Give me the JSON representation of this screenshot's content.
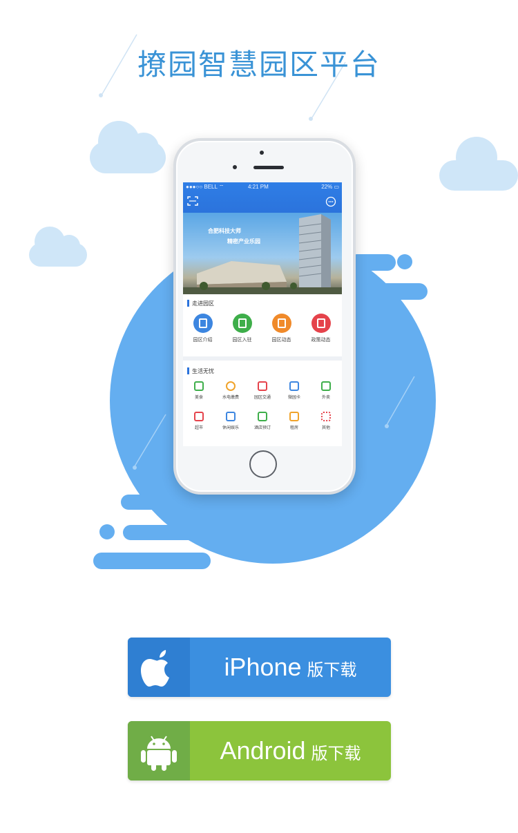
{
  "title": "撩园智慧园区平台",
  "colors": {
    "accent_blue": "#3a93d6",
    "blob_blue": "#64aef0",
    "android_green": "#8cc43c",
    "ios_blue": "#3b8fe0"
  },
  "phone": {
    "status": {
      "carrier": "●●●○○ BELL ⌔",
      "time": "4:21 PM",
      "battery": "22% ▭"
    },
    "banner": {
      "line1": "合肥科技大师",
      "line2": "精密产业乐园"
    },
    "section1": {
      "title": "走进园区",
      "items": [
        {
          "label": "园区介绍",
          "color": "#3d86e0"
        },
        {
          "label": "园区入驻",
          "color": "#3eae4a"
        },
        {
          "label": "园区动态",
          "color": "#f08a2a"
        },
        {
          "label": "政策动态",
          "color": "#e5434b"
        }
      ]
    },
    "section2": {
      "title": "生活无忧",
      "row1": [
        {
          "label": "美食",
          "color": "#3eae4a"
        },
        {
          "label": "水电缴费",
          "color": "#f0a32a"
        },
        {
          "label": "园区交通",
          "color": "#e5434b"
        },
        {
          "label": "微园卡",
          "color": "#3d86e0"
        },
        {
          "label": "外卖",
          "color": "#3eae4a"
        }
      ],
      "row2": [
        {
          "label": "超市",
          "color": "#e5434b"
        },
        {
          "label": "休闲娱乐",
          "color": "#3d86e0"
        },
        {
          "label": "酒店预订",
          "color": "#3eae4a"
        },
        {
          "label": "租房",
          "color": "#f0a32a"
        },
        {
          "label": "其他",
          "color": "#e5434b"
        }
      ]
    }
  },
  "buttons": {
    "iphone": {
      "main": "iPhone",
      "sub": "版下载",
      "icon": "apple-icon"
    },
    "android": {
      "main": "Android",
      "sub": "版下载",
      "icon": "android-icon"
    }
  }
}
